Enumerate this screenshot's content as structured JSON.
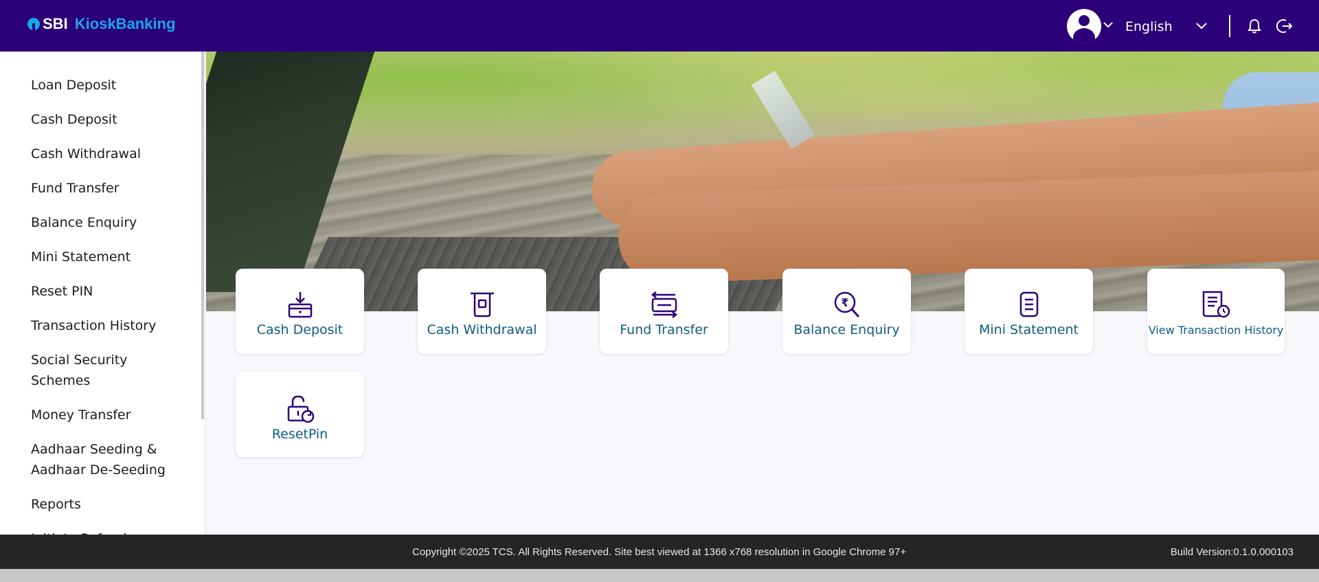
{
  "header": {
    "logo_sbi": "SBI",
    "logo_product": "KioskBanking",
    "language": "English",
    "bg_color": "#2c0078",
    "accent_color": "#18a6e8"
  },
  "sidebar": {
    "items": [
      {
        "label": "Loan Deposit"
      },
      {
        "label": "Cash Deposit"
      },
      {
        "label": "Cash Withdrawal"
      },
      {
        "label": "Fund Transfer"
      },
      {
        "label": "Balance Enquiry"
      },
      {
        "label": "Mini Statement"
      },
      {
        "label": "Reset PIN"
      },
      {
        "label": "Transaction History"
      },
      {
        "label": "Social Security Schemes"
      },
      {
        "label": "Money Transfer"
      },
      {
        "label": "Aadhaar Seeding & Aadhaar De-Seeding"
      },
      {
        "label": "Reports"
      },
      {
        "label": "Initiate Refund"
      }
    ]
  },
  "tiles": [
    {
      "label": "Cash Deposit",
      "icon": "deposit-icon"
    },
    {
      "label": "Cash Withdrawal",
      "icon": "withdrawal-icon"
    },
    {
      "label": "Fund Transfer",
      "icon": "transfer-icon"
    },
    {
      "label": "Balance Enquiry",
      "icon": "balance-enquiry-icon"
    },
    {
      "label": "Mini Statement",
      "icon": "statement-icon"
    },
    {
      "label": "View Transaction History",
      "icon": "transaction-history-icon"
    },
    {
      "label": "ResetPin",
      "icon": "reset-pin-icon"
    }
  ],
  "footer": {
    "copyright": "Copyright ©2025 TCS. All Rights Reserved. Site best viewed at 1366 x768 resolution in Google Chrome 97+",
    "build": "Build Version:0.1.0.000103"
  }
}
